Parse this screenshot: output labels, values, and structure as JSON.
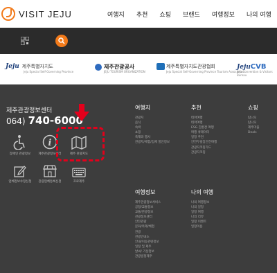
{
  "header": {
    "logo_text": "VISIT JEJU",
    "nav": [
      "여행지",
      "추천",
      "쇼핑",
      "브랜드",
      "여행정보",
      "나의 여행"
    ]
  },
  "partners": [
    {
      "name": "Jeju",
      "text": "제주특별자치도",
      "sub": "Jeju Special Self-Governing Province"
    },
    {
      "name": "",
      "text": "제주관광공사",
      "sub": "JEJU TOURISM ORGANIZATION"
    },
    {
      "name": "",
      "text": "제주특별자치도관광협회",
      "sub": "Jeju Special Self-Governing Province Tourism Association"
    },
    {
      "name": "Jeju",
      "text": "CVB",
      "sub": "Jeju Convention & Visitors Bureau"
    }
  ],
  "footer": {
    "center_title": "제주관광정보센터",
    "phone_code": "064)",
    "phone_number": "740-6000",
    "services": [
      {
        "label": "장애인 관광정보",
        "icon": "wheelchair-icon"
      },
      {
        "label": "제주관광정보센터",
        "icon": "info-icon"
      },
      {
        "label": "제주 관광지도",
        "icon": "map-icon"
      },
      {
        "label": "업체정보수정신청",
        "icon": "edit-icon"
      },
      {
        "label": "관광업체등록신청",
        "icon": "store-icon"
      },
      {
        "label": "프로제주",
        "icon": "keyboard-icon"
      }
    ],
    "columns": {
      "travel": {
        "title": "여행지",
        "items": [
          "관광지",
          "음식",
          "숙박",
          "쇼핑",
          "축제와 행사",
          "관광지/체험/업체 할인정보"
        ]
      },
      "recommend": {
        "title": "추천",
        "items": [
          "테마여행",
          "테마여행",
          "ESG 친환경 여행",
          "여행 큐레이터",
          "일정 추천",
          "안전두릴장안전여행",
          "관광지코칭가드",
          "관광지코칭"
        ]
      },
      "shopping": {
        "title": "쇼핑",
        "items": [
          "탐나오",
          "탐나오",
          "제주마을",
          "Deals"
        ]
      },
      "info": {
        "title": "여행정보",
        "items": [
          "제주관광정보서비스",
          "공항/교통정보",
          "교통/관광정보",
          "관광정보센터",
          "안전관광",
          "문화/축제/체험",
          "관광",
          "관광안내소",
          "안내/이동관련정보",
          "일정 및 제주",
          "날씨/ 기상정보",
          "관광일정제주"
        ]
      },
      "mytrip": {
        "title": "나의 여행",
        "items": [
          "나의 여행정보",
          "나의 일정",
          "일정 여행",
          "나의 리뷰",
          "일정 이벤트",
          "일정이용"
        ]
      }
    }
  }
}
